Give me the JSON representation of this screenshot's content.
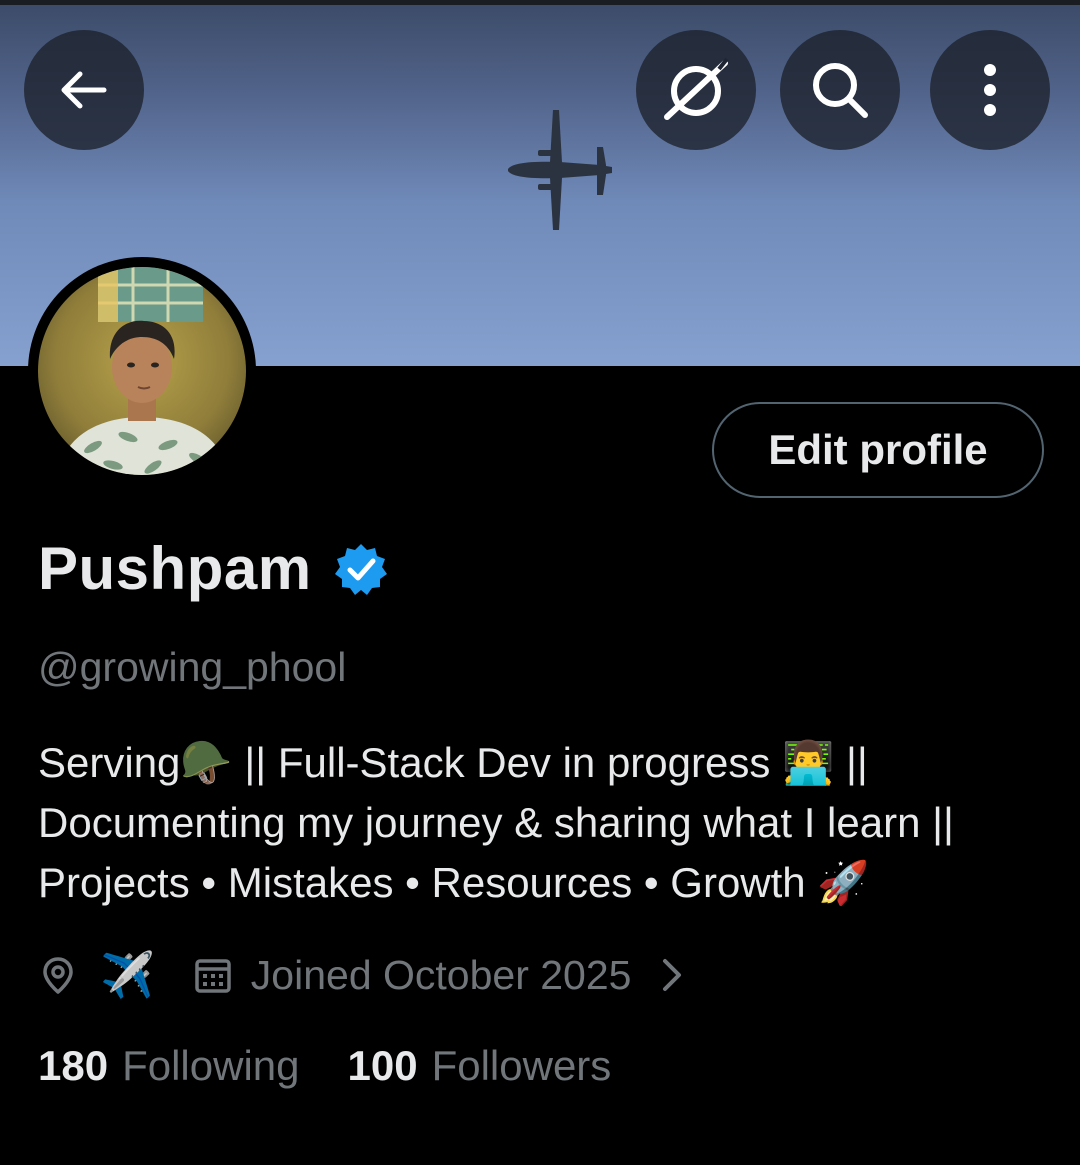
{
  "header": {
    "back_icon": "arrow-left-icon",
    "grok_icon": "grok-icon",
    "search_icon": "search-icon",
    "more_icon": "more-vertical-icon"
  },
  "profile": {
    "name": "Pushpam",
    "verified": true,
    "handle": "@growing_phool",
    "edit_label": "Edit profile",
    "bio_lines": [
      "Serving🪖 || Full-Stack Dev in progress 👨‍💻 ||",
      "Documenting my journey & sharing what I learn ||",
      "Projects • Mistakes • Resources • Growth 🚀"
    ],
    "location": "✈️",
    "joined": "Joined October 2025"
  },
  "stats": {
    "following_count": "180",
    "following_label": "Following",
    "followers_count": "100",
    "followers_label": "Followers"
  },
  "colors": {
    "background": "#000000",
    "primary_text": "#e7e9ea",
    "secondary_text": "#71767b",
    "verified_blue": "#1d9bf0",
    "button_border": "#536471"
  }
}
